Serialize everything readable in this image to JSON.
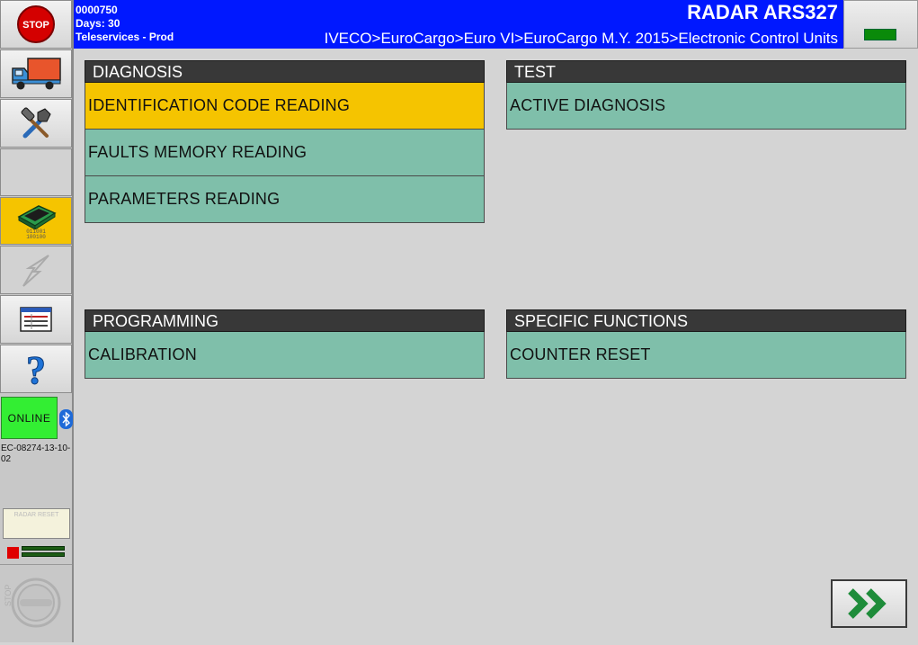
{
  "header": {
    "code": "0000750",
    "days": "Days: 30",
    "service": "Teleservices - Prod",
    "title": "RADAR ARS327",
    "breadcrumb": "IVECO>EuroCargo>Euro VI>EuroCargo M.Y. 2015>Electronic Control Units"
  },
  "sidebar": {
    "stop_label": "STOP",
    "online_label": "ONLINE",
    "device_id": "EC-08274-13-10-02",
    "radar_reset_label": "RADAR RESET",
    "ecu_digits": "011001\n100100",
    "buttons": [
      {
        "icon": "truck-icon"
      },
      {
        "icon": "tools-icon"
      },
      {
        "icon": "ecu-icon",
        "state": "active"
      },
      {
        "icon": "lightning-icon",
        "state": "disabled"
      },
      {
        "icon": "document-list-icon"
      },
      {
        "icon": "help-icon"
      }
    ]
  },
  "panels": {
    "diagnosis": {
      "title": "DIAGNOSIS",
      "items": [
        "IDENTIFICATION CODE READING",
        "FAULTS MEMORY READING",
        "PARAMETERS READING"
      ],
      "selected_index": 0
    },
    "test": {
      "title": "TEST",
      "items": [
        "ACTIVE DIAGNOSIS"
      ]
    },
    "programming": {
      "title": "PROGRAMMING",
      "items": [
        "CALIBRATION"
      ]
    },
    "specific_functions": {
      "title": "SPECIFIC FUNCTIONS",
      "items": [
        "COUNTER RESET"
      ]
    }
  },
  "colors": {
    "header_bg": "#0018ff",
    "item_bg": "#7fbfaa",
    "selected_bg": "#f5c400",
    "panel_title_bg": "#383838",
    "online_bg": "#33ee33"
  },
  "next_button_icon": "double-chevron-right-icon"
}
